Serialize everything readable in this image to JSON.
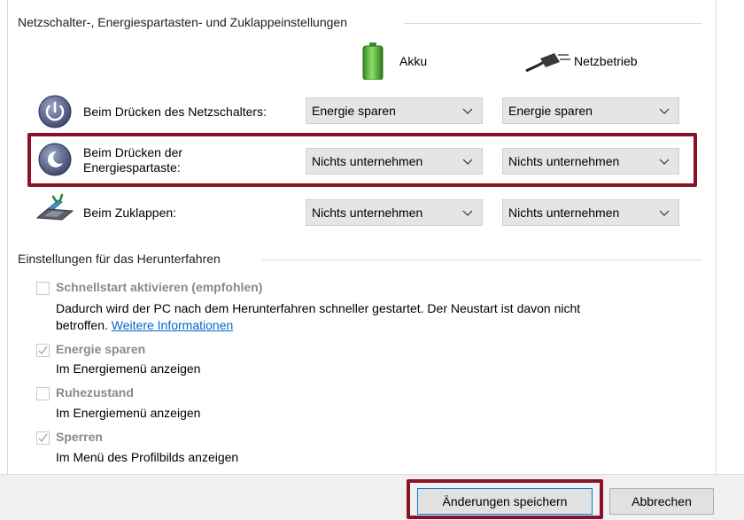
{
  "power_buttons": {
    "section_title": "Netzschalter-, Energiespartasten- und Zuklappeinstellungen",
    "columns": {
      "battery": "Akku",
      "plugged_in": "Netzbetrieb"
    },
    "rows": [
      {
        "label": "Beim Drücken des Netzschalters:",
        "battery": "Energie sparen",
        "plugged_in": "Energie sparen"
      },
      {
        "label_line1": "Beim Drücken der",
        "label_line2": "Energiespartaste:",
        "battery": "Nichts unternehmen",
        "plugged_in": "Nichts unternehmen"
      },
      {
        "label": "Beim Zuklappen:",
        "battery": "Nichts unternehmen",
        "plugged_in": "Nichts unternehmen"
      }
    ]
  },
  "shutdown": {
    "section_title": "Einstellungen für das Herunterfahren",
    "options": [
      {
        "title": "Schnellstart aktivieren (empfohlen)",
        "checked": false,
        "desc_line1": "Dadurch wird der PC nach dem Herunterfahren schneller gestartet. Der Neustart ist davon nicht",
        "desc_line2": "betroffen.",
        "link": "Weitere Informationen"
      },
      {
        "title": "Energie sparen",
        "checked": true,
        "desc": "Im Energiemenü anzeigen"
      },
      {
        "title": "Ruhezustand",
        "checked": false,
        "desc": "Im Energiemenü anzeigen"
      },
      {
        "title": "Sperren",
        "checked": true,
        "desc": "Im Menü des Profilbilds anzeigen"
      }
    ]
  },
  "footer": {
    "save_label": "Änderungen speichern",
    "cancel_label": "Abbrechen"
  },
  "colors": {
    "highlight": "#8b1029",
    "link": "#0066cc",
    "dropdown_bg": "#e5e5e5"
  },
  "icons": [
    "battery-icon",
    "power-plug-icon",
    "power-button-icon",
    "sleep-button-icon",
    "laptop-lid-icon",
    "chevron-down-icon",
    "checkmark-icon"
  ]
}
